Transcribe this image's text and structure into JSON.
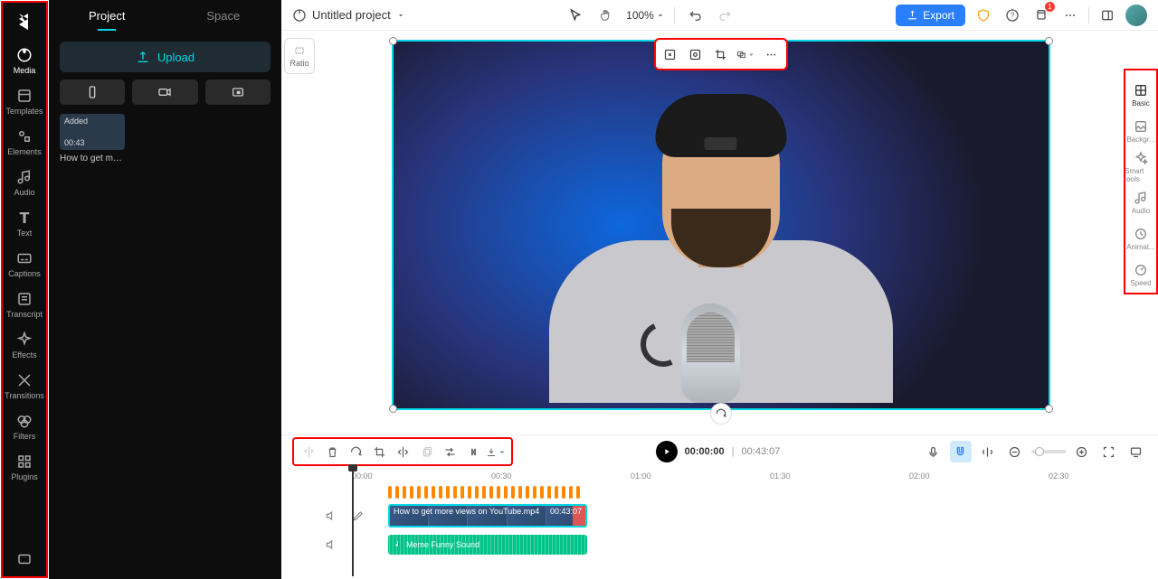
{
  "leftNav": [
    {
      "id": "media",
      "label": "Media"
    },
    {
      "id": "templates",
      "label": "Templates"
    },
    {
      "id": "elements",
      "label": "Elements"
    },
    {
      "id": "audio",
      "label": "Audio"
    },
    {
      "id": "text",
      "label": "Text"
    },
    {
      "id": "captions",
      "label": "Captions"
    },
    {
      "id": "transcript",
      "label": "Transcript"
    },
    {
      "id": "effects",
      "label": "Effects"
    },
    {
      "id": "transitions",
      "label": "Transitions"
    },
    {
      "id": "filters",
      "label": "Filters"
    },
    {
      "id": "plugins",
      "label": "Plugins"
    }
  ],
  "sideTabs": {
    "project": "Project",
    "space": "Space"
  },
  "upload": "Upload",
  "mediaItem": {
    "badge": "Added",
    "duration": "00:43",
    "title": "How to get mor..."
  },
  "project": {
    "title": "Untitled project"
  },
  "zoom": "100%",
  "export": "Export",
  "notifCount": "1",
  "ratio": "Ratio",
  "timecode": {
    "current": "00:00:00",
    "total": "00:43:07"
  },
  "ruler": [
    "00:00",
    "00:30",
    "01:00",
    "01:30",
    "02:00",
    "02:30"
  ],
  "videoClip": {
    "label": "How to get more views on YouTube.mp4",
    "dur": "00:43:07"
  },
  "audioClip": {
    "label": "Meme Funny Sound"
  },
  "rightNav": [
    {
      "id": "basic",
      "label": "Basic"
    },
    {
      "id": "backgr",
      "label": "Backgr..."
    },
    {
      "id": "smart",
      "label": "Smart tools"
    },
    {
      "id": "raudio",
      "label": "Audio"
    },
    {
      "id": "animat",
      "label": "Animat..."
    },
    {
      "id": "speed",
      "label": "Speed"
    }
  ]
}
